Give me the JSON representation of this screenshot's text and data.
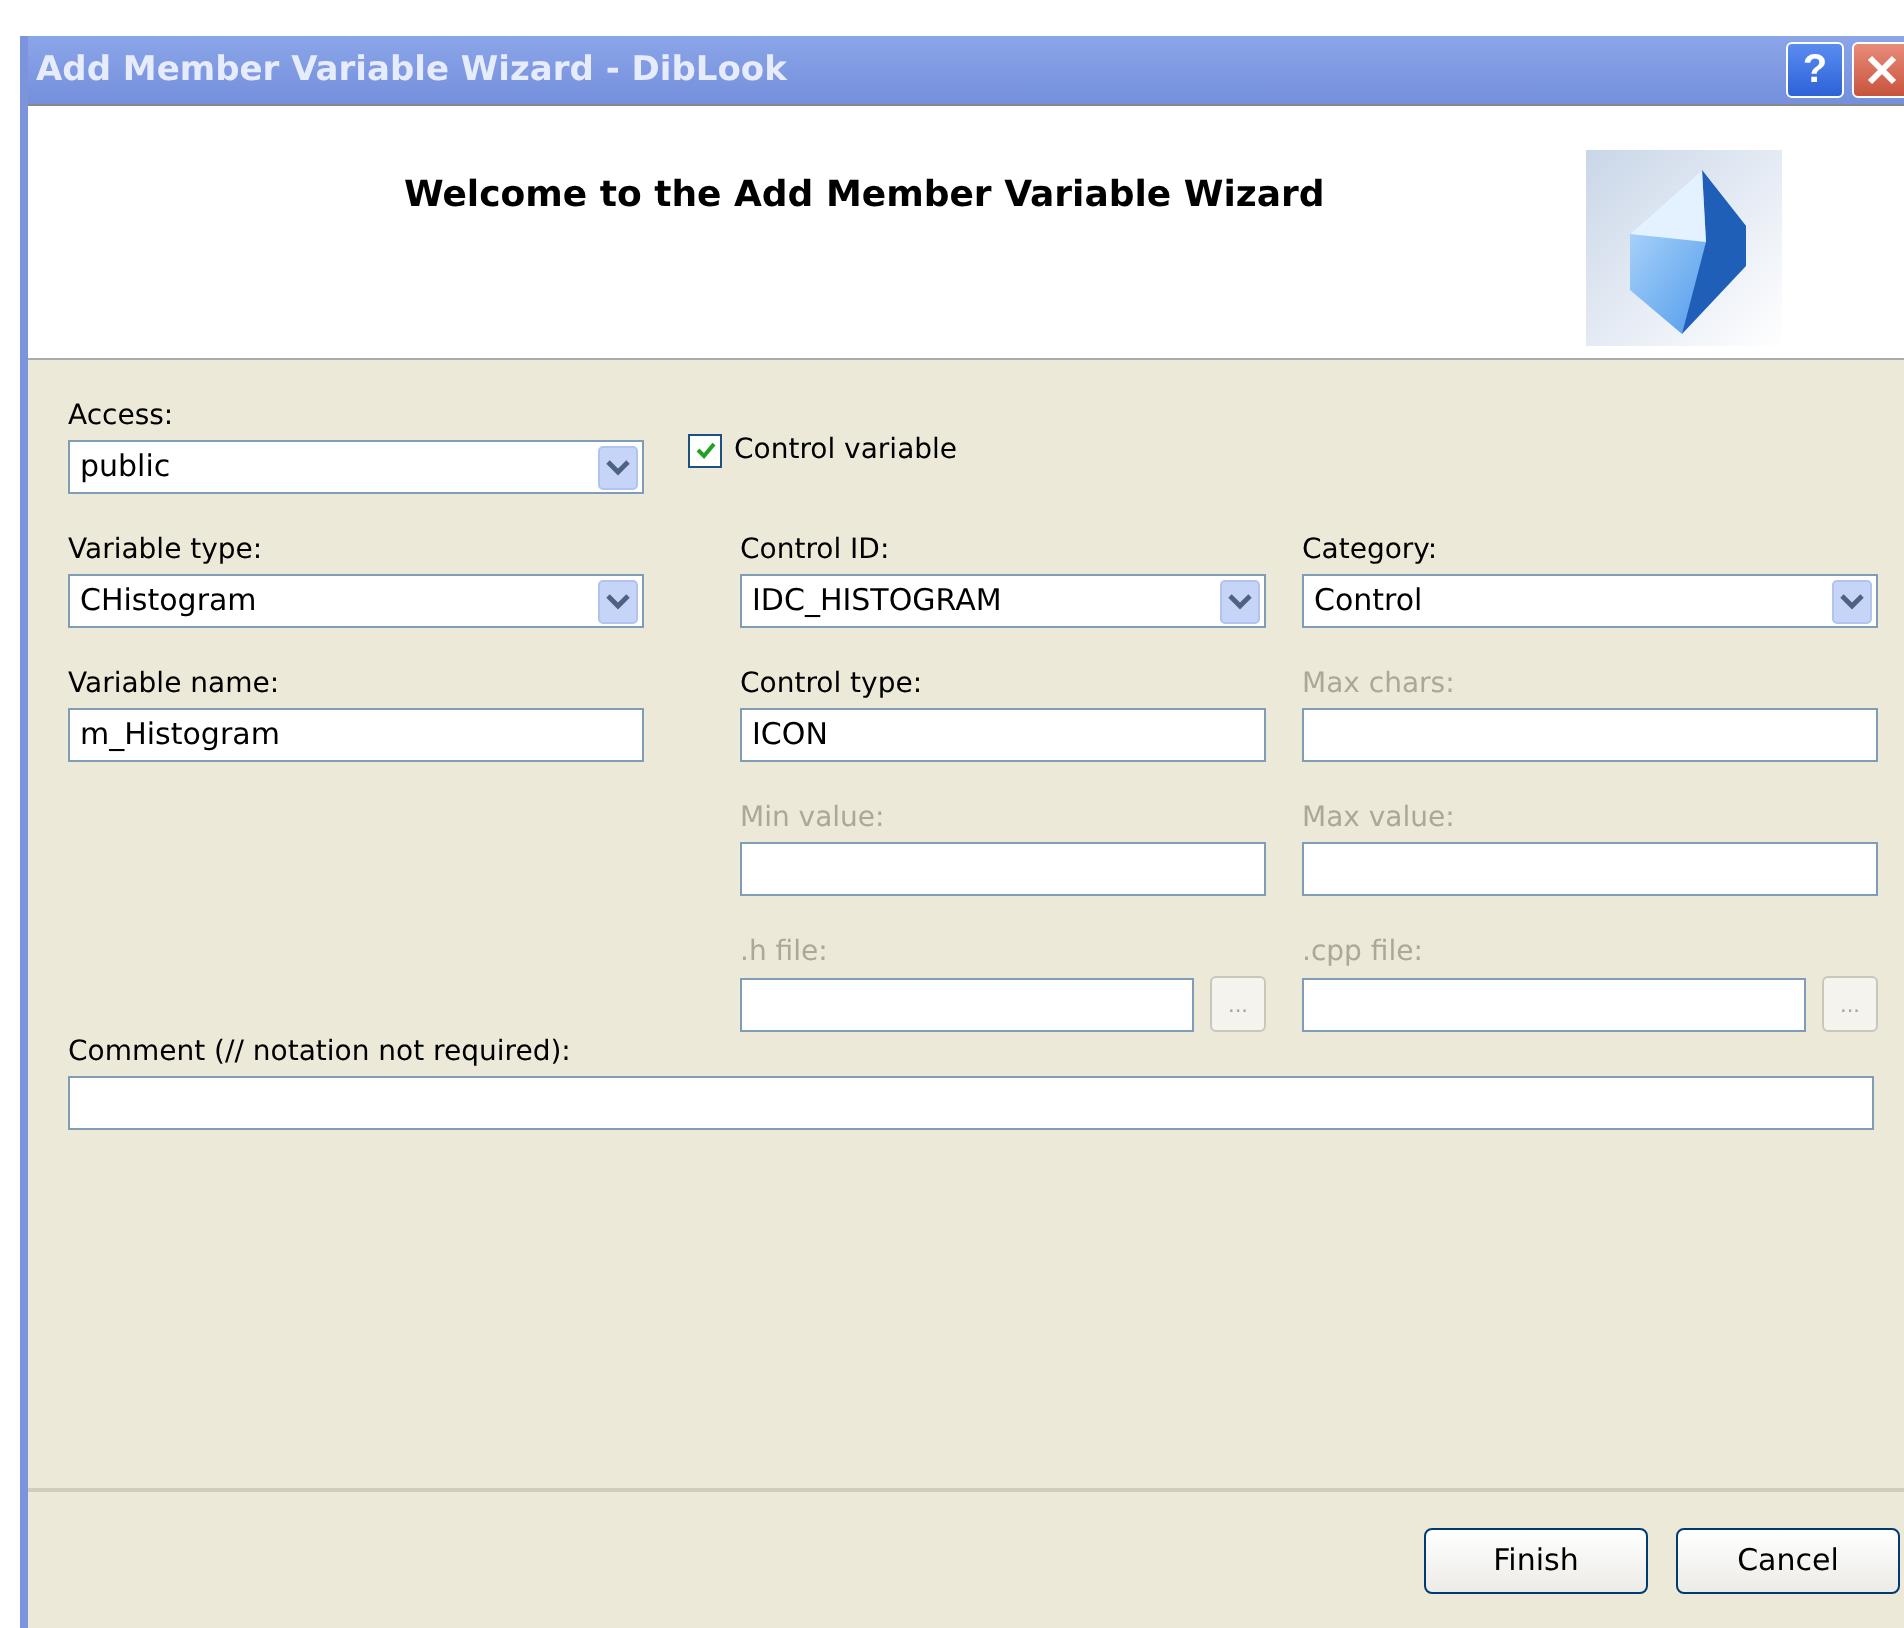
{
  "window": {
    "title": "Add Member Variable Wizard - DibLook",
    "help_button": "?"
  },
  "header": {
    "heading": "Welcome to the Add Member Variable Wizard"
  },
  "form": {
    "left": [
      {
        "kind": "combo",
        "label": "Access:",
        "value": "public",
        "disabled": false
      },
      {
        "kind": "combo",
        "label": "Variable type:",
        "value": "CHistogram",
        "disabled": false
      },
      {
        "kind": "text",
        "label": "Variable name:",
        "value": "m_Histogram",
        "disabled": false
      }
    ],
    "middle": [
      {
        "kind": "check",
        "label": "Control variable",
        "checked": true
      },
      {
        "kind": "combo",
        "label": "Control ID:",
        "value": "IDC_HISTOGRAM",
        "disabled": false
      },
      {
        "kind": "text",
        "label": "Control type:",
        "value": "ICON",
        "disabled": false
      },
      {
        "kind": "text",
        "label": "Min value:",
        "disabled": true
      },
      {
        "kind": "browse",
        "label": ".h file:",
        "button": "...",
        "disabled": true
      }
    ],
    "right": [
      {
        "kind": "combo",
        "label": "Category:",
        "value": "Control",
        "disabled": false
      },
      {
        "kind": "text",
        "label": "Max chars:",
        "disabled": true
      },
      {
        "kind": "text",
        "label": "Max value:",
        "disabled": true
      },
      {
        "kind": "browse",
        "label": ".cpp file:",
        "button": "...",
        "disabled": true
      }
    ],
    "comment": {
      "kind": "text",
      "label": "Comment (// notation not required):",
      "disabled": false
    }
  },
  "buttons": [
    "Finish",
    "Cancel"
  ]
}
